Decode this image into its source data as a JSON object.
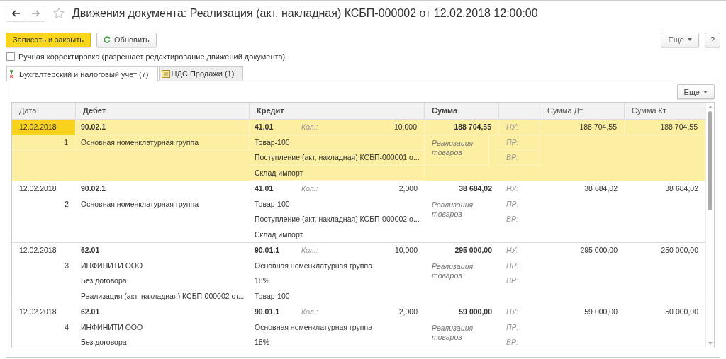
{
  "window": {
    "title": "Движения документа: Реализация (акт, накладная) КСБП-000002 от 12.02.2018 12:00:00"
  },
  "toolbar": {
    "primary_button": "Записать и закрыть",
    "refresh_button": "Обновить",
    "more_button": "Еще",
    "help_button": "?"
  },
  "manual_edit": {
    "label": "Ручная корректировка (разрешает редактирование движений документа)",
    "checked": false
  },
  "tabs": [
    {
      "label": "Бухгалтерский и налоговый учет (7)",
      "selected": true,
      "kind": "ledger"
    },
    {
      "label": "НДС Продажи (1)",
      "selected": false,
      "kind": "register"
    }
  ],
  "table": {
    "more_button": "Еще",
    "columns": [
      "Дата",
      "Дебет",
      "Кредит",
      "Сумма",
      "",
      "Сумма Дт",
      "Сумма Кт"
    ],
    "rows": [
      {
        "date": "12.02.2018",
        "number": "1",
        "selected": true,
        "debit": [
          "90.02.1",
          "Основная номенклатурная группа"
        ],
        "credit_account": "41.01",
        "qty_label": "Кол.:",
        "qty": "10,000",
        "credit": [
          "Товар-100",
          "Поступление (акт, накладная) КСБП-000001 о...",
          "Склад импорт"
        ],
        "amount": "188 704,55",
        "content": "Реализация товаров",
        "tax_labels": [
          "НУ:",
          "ПР:",
          "ВР:"
        ],
        "sum_dt": "188 704,55",
        "sum_kt": "188 704,55"
      },
      {
        "date": "12.02.2018",
        "number": "2",
        "selected": false,
        "debit": [
          "90.02.1",
          "Основная номенклатурная группа"
        ],
        "credit_account": "41.01",
        "qty_label": "Кол.:",
        "qty": "2,000",
        "credit": [
          "Товар-100",
          "Поступление (акт, накладная) КСБП-000002 о...",
          "Склад импорт"
        ],
        "amount": "38 684,02",
        "content": "Реализация товаров",
        "tax_labels": [
          "НУ:",
          "ПР:",
          "ВР:"
        ],
        "sum_dt": "38 684,02",
        "sum_kt": "38 684,02"
      },
      {
        "date": "12.02.2018",
        "number": "3",
        "selected": false,
        "debit": [
          "62.01",
          "ИНФИНИТИ ООО",
          "Без договора",
          "Реализация (акт, накладная) КСБП-000002 от..."
        ],
        "credit_account": "90.01.1",
        "qty_label": "Кол.:",
        "qty": "10,000",
        "credit": [
          "Основная номенклатурная группа",
          "18%",
          "Товар-100"
        ],
        "amount": "295 000,00",
        "content": "Реализация товаров",
        "tax_labels": [
          "НУ:",
          "ПР:",
          "ВР:"
        ],
        "sum_dt": "295 000,00",
        "sum_kt": "250 000,00"
      },
      {
        "date": "12.02.2018",
        "number": "4",
        "selected": false,
        "debit": [
          "62.01",
          "ИНФИНИТИ ООО",
          "Без договора"
        ],
        "credit_account": "90.01.1",
        "qty_label": "Кол.:",
        "qty": "2,000",
        "credit": [
          "Основная номенклатурная группа",
          "18%"
        ],
        "amount": "59 000,00",
        "content": "Реализация товаров",
        "tax_labels": [
          "НУ:",
          "ПР:",
          "ВР:"
        ],
        "sum_dt": "59 000,00",
        "sum_kt": "50 000,00"
      }
    ]
  }
}
